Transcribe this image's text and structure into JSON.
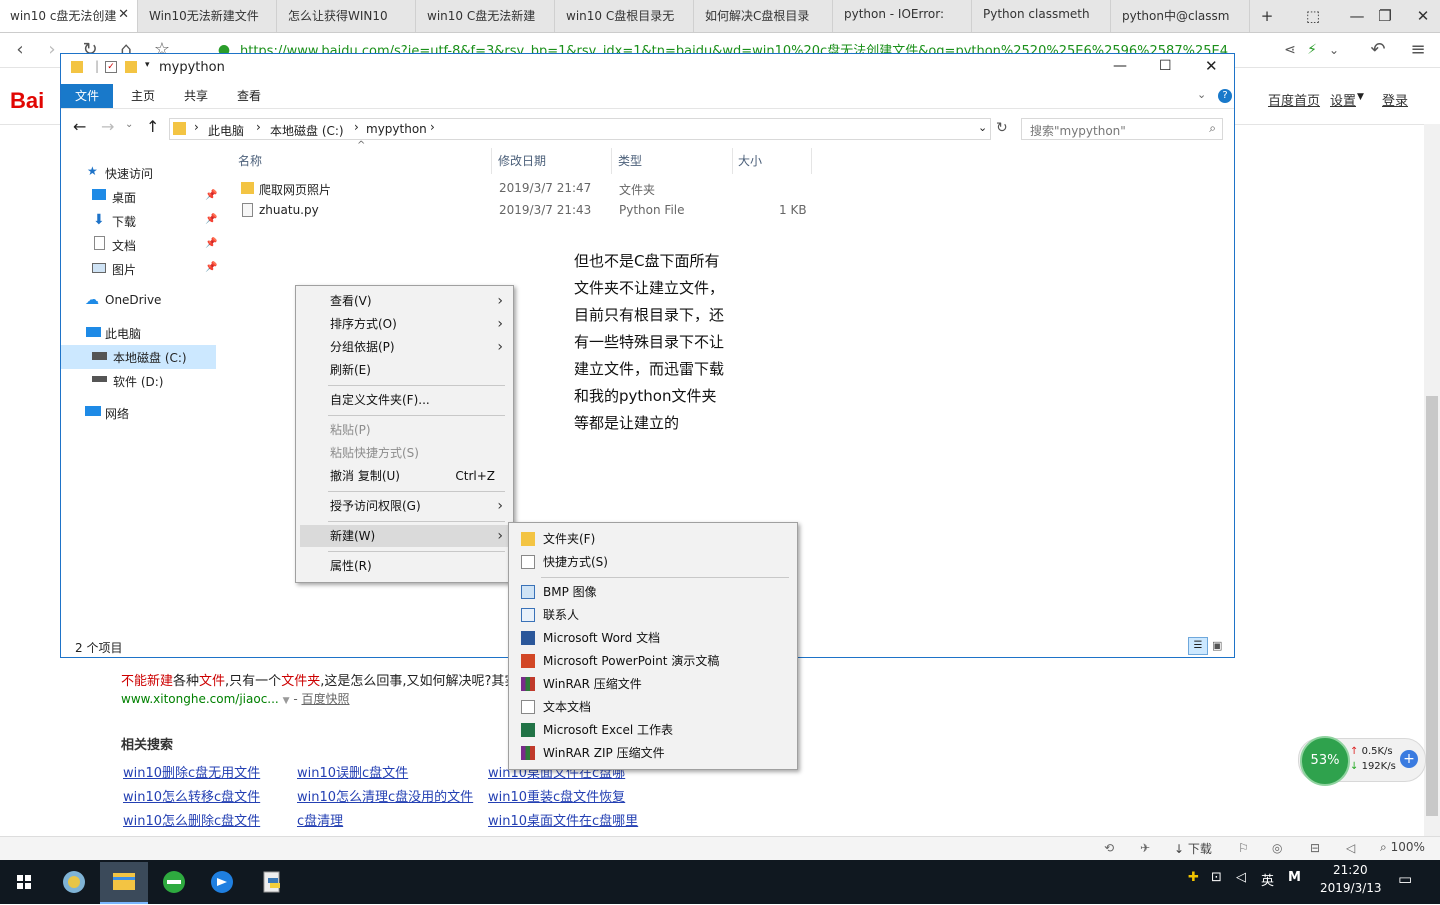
{
  "browser": {
    "tabs": [
      {
        "label": "win10 c盘无法创建"
      },
      {
        "label": "Win10无法新建文件"
      },
      {
        "label": "怎么让获得WIN10"
      },
      {
        "label": "win10 C盘无法新建"
      },
      {
        "label": "win10 C盘根目录无"
      },
      {
        "label": "如何解决C盘根目录"
      },
      {
        "label": "python - IOError:"
      },
      {
        "label": "Python classmeth"
      },
      {
        "label": "python中@classm"
      }
    ],
    "url": "https://www.baidu.com/s?ie=utf-8&f=3&rsv_bp=1&rsv_idx=1&tn=baidu&wd=win10%20c盘无法创建文件&oq=python%2520%25E6%2596%2587%25E4",
    "status_download": "下载",
    "zoom": "100%"
  },
  "baidu": {
    "logo": "Bai",
    "top_links": [
      "百度首页",
      "设置",
      "登录"
    ],
    "result_snippet_1": "不能新建",
    "result_snippet_2": "各种",
    "result_snippet_3": "文件",
    "result_snippet_4": ",只有一个",
    "result_snippet_5": "文件夹",
    "result_snippet_6": ",这是怎么回事,又如何解决呢?其实",
    "result_url": "www.xitonghe.com/jiaoc...",
    "result_cache": "百度快照",
    "related_title": "相关搜索",
    "related": [
      [
        "win10删除c盘无用文件",
        "win10误删c盘文件",
        "win10桌面文件在c盘哪"
      ],
      [
        "win10怎么转移c盘文件",
        "win10怎么清理c盘没用的文件",
        "win10重装c盘文件恢复"
      ],
      [
        "win10怎么删除c盘文件",
        "c盘清理",
        "win10桌面文件在c盘哪里"
      ]
    ]
  },
  "explorer": {
    "title": "mypython",
    "ribbon_tabs": [
      "文件",
      "主页",
      "共享",
      "查看"
    ],
    "breadcrumb": [
      "此电脑",
      "本地磁盘 (C:)",
      "mypython"
    ],
    "search_placeholder": "搜索\"mypython\"",
    "nav": {
      "quick_access": "快速访问",
      "desktop": "桌面",
      "downloads": "下载",
      "documents": "文档",
      "pictures": "图片",
      "onedrive": "OneDrive",
      "this_pc": "此电脑",
      "local_disk": "本地磁盘 (C:)",
      "soft_disk": "软件 (D:)",
      "network": "网络"
    },
    "columns": [
      "名称",
      "修改日期",
      "类型",
      "大小"
    ],
    "files": [
      {
        "name": "爬取网页照片",
        "date": "2019/3/7 21:47",
        "type": "文件夹",
        "size": ""
      },
      {
        "name": "zhuatu.py",
        "date": "2019/3/7 21:43",
        "type": "Python File",
        "size": "1 KB"
      }
    ],
    "status": "2 个项目"
  },
  "annotation_lines": [
    "但也不是C盘下面所有",
    "文件夹不让建立文件，",
    "目前只有根目录下，还",
    "有一些特殊目录下不让",
    "建立文件，而迅雷下载",
    "和我的python文件夹",
    "等都是让建立的"
  ],
  "context_menu": {
    "view": "查看(V)",
    "sort": "排序方式(O)",
    "group": "分组依据(P)",
    "refresh": "刷新(E)",
    "customize": "自定义文件夹(F)...",
    "paste": "粘贴(P)",
    "paste_shortcut": "粘贴快捷方式(S)",
    "undo": "撤消 复制(U)",
    "undo_shortcut": "Ctrl+Z",
    "grant_access": "授予访问权限(G)",
    "new": "新建(W)",
    "properties": "属性(R)"
  },
  "new_submenu": {
    "folder": "文件夹(F)",
    "shortcut": "快捷方式(S)",
    "bmp": "BMP 图像",
    "contact": "联系人",
    "word": "Microsoft Word 文档",
    "ppt": "Microsoft PowerPoint 演示文稿",
    "winrar": "WinRAR 压缩文件",
    "text": "文本文档",
    "excel": "Microsoft Excel 工作表",
    "winrar_zip": "WinRAR ZIP 压缩文件"
  },
  "net_widget": {
    "percent": "53%",
    "up": "0.5K/s",
    "down": "192K/s"
  },
  "taskbar": {
    "ime": "英",
    "time": "21:20",
    "date": "2019/3/13"
  },
  "colors": {
    "accent": "#1979ca",
    "logo_red": "#e10602",
    "link_blue": "#2440b3",
    "url_green": "#1a8f1a"
  }
}
